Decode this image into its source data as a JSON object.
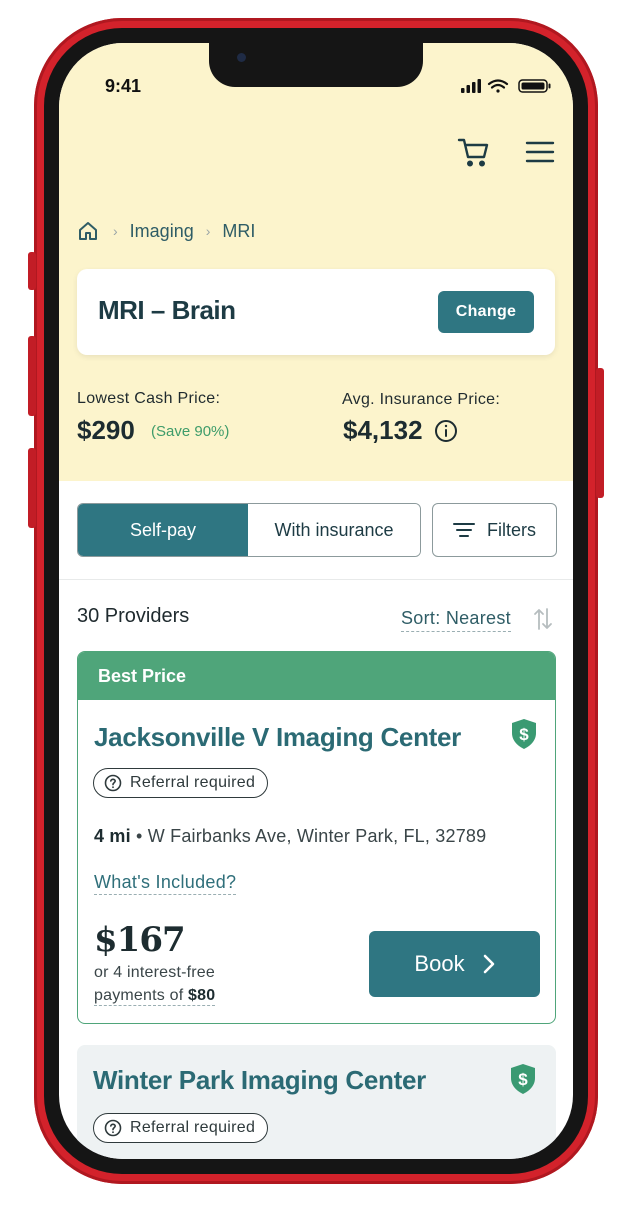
{
  "status_bar": {
    "time": "9:41"
  },
  "icons": {
    "cart": "cart-icon",
    "menu": "menu-icon",
    "home": "home-icon",
    "info": "info-icon",
    "shield": "shield-dollar-icon",
    "question": "question-circle-icon",
    "sort": "sort-arrows-icon",
    "filter": "filter-lines-icon",
    "chevron": "chevron-right-icon"
  },
  "breadcrumb": {
    "items": [
      "Imaging",
      "MRI"
    ],
    "separator": "›"
  },
  "procedure": {
    "title": "MRI – Brain",
    "change_label": "Change"
  },
  "prices": {
    "lowest_cash_label": "Lowest Cash Price:",
    "lowest_cash_value": "$290",
    "savings": "(Save 90%)",
    "avg_insurance_label": "Avg. Insurance Price:",
    "avg_insurance_value": "$4,132"
  },
  "payment_toggle": {
    "options": [
      "Self-pay",
      "With insurance"
    ],
    "selected": "Self-pay"
  },
  "filters_label": "Filters",
  "results": {
    "count_label": "30 Providers",
    "sort_label": "Sort: Nearest"
  },
  "providers": [
    {
      "badge": "Best Price",
      "name": "Jacksonville V Imaging Center",
      "referral": "Referral required",
      "distance": "4 mi",
      "address": "W Fairbanks Ave, Winter Park, FL, 32789",
      "included_label": "What's Included?",
      "price": "$167",
      "installment_line1": "or 4 interest-free",
      "installment_line2": "payments of",
      "installment_amount": "$80",
      "book_label": "Book"
    },
    {
      "name": "Winter Park Imaging Center",
      "referral": "Referral required"
    }
  ],
  "colors": {
    "accent": "#2f7682",
    "best_price": "#4fa57a",
    "hero_bg": "#fcf4cc",
    "phone_frame": "#d3222b"
  }
}
